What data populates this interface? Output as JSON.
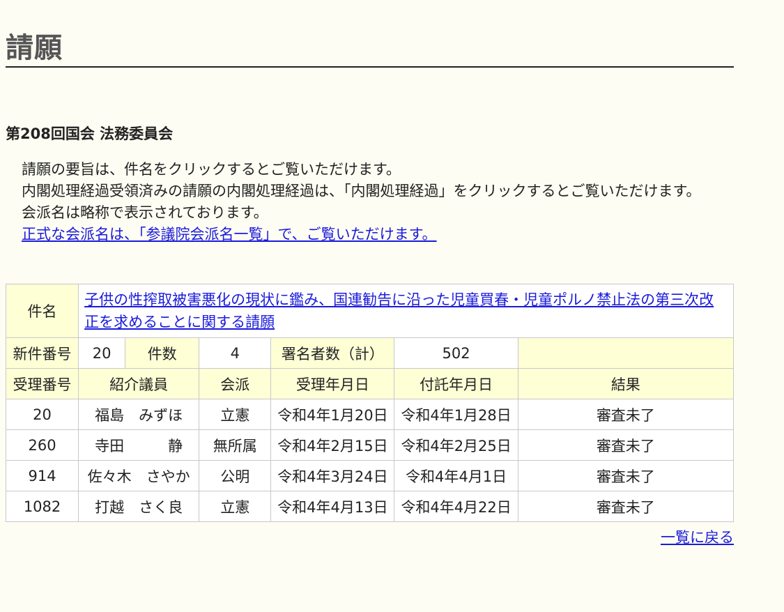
{
  "page": {
    "title": "請願",
    "subtitle": "第208回国会 法務委員会",
    "notes": [
      "請願の要旨は、件名をクリックするとご覧いただけます。",
      "内閣処理経過受領済みの請願の内閣処理経過は、「内閣処理経過」をクリックするとご覧いただけます。",
      "会派名は略称で表示されております。"
    ],
    "faction_link": "正式な会派名は、「参議院会派名一覧」で、ご覧いただけます。",
    "back_link": "一覧に戻る"
  },
  "petition": {
    "subject_label": "件名",
    "subject": "子供の性搾取被害悪化の現状に鑑み、国連勧告に沿った児童買春・児童ポルノ禁止法の第三次改正を求めることに関する請願",
    "new_number_label": "新件番号",
    "new_number": "20",
    "count_label": "件数",
    "count": "4",
    "signers_label": "署名者数（計）",
    "signers": "502"
  },
  "table": {
    "columns": [
      "受理番号",
      "紹介議員",
      "会派",
      "受理年月日",
      "付託年月日",
      "結果"
    ],
    "rows": [
      [
        "20",
        "福島　みずほ",
        "立憲",
        "令和4年1月20日",
        "令和4年1月28日",
        "審査未了"
      ],
      [
        "260",
        "寺田　　　静",
        "無所属",
        "令和4年2月15日",
        "令和4年2月25日",
        "審査未了"
      ],
      [
        "914",
        "佐々木　さやか",
        "公明",
        "令和4年3月24日",
        "令和4年4月1日",
        "審査未了"
      ],
      [
        "1082",
        "打越　さく良",
        "立憲",
        "令和4年4月13日",
        "令和4年4月22日",
        "審査未了"
      ]
    ]
  }
}
